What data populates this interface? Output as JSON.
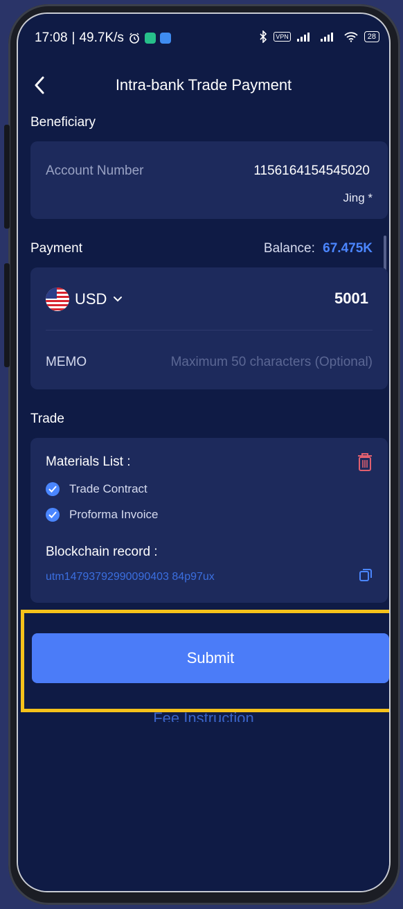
{
  "status_bar": {
    "time": "17:08",
    "speed": "49.7K/s",
    "vpn": "VPN",
    "battery": "28"
  },
  "header": {
    "title": "Intra-bank Trade Payment"
  },
  "beneficiary": {
    "section_label": "Beneficiary",
    "account_label": "Account Number",
    "account_number": "1156164154545020",
    "account_name": "Jing *"
  },
  "payment": {
    "section_label": "Payment",
    "balance_label": "Balance:",
    "balance_value": "67.475K",
    "currency": "USD",
    "amount": "5001",
    "memo_label": "MEMO",
    "memo_placeholder": "Maximum 50 characters (Optional)"
  },
  "trade": {
    "section_label": "Trade",
    "materials_label": "Materials List :",
    "materials": [
      "Trade Contract",
      "Proforma Invoice"
    ],
    "blockchain_label": "Blockchain record :",
    "blockchain_value": "utm14793792990090403 84p97ux"
  },
  "actions": {
    "submit_label": "Submit",
    "fee_link": "Fee Instruction"
  },
  "colors": {
    "accent": "#4b7cf8",
    "highlight": "#f5c21b",
    "background": "#0f1b45",
    "card": "#1d2a5c",
    "delete": "#e0606f"
  }
}
